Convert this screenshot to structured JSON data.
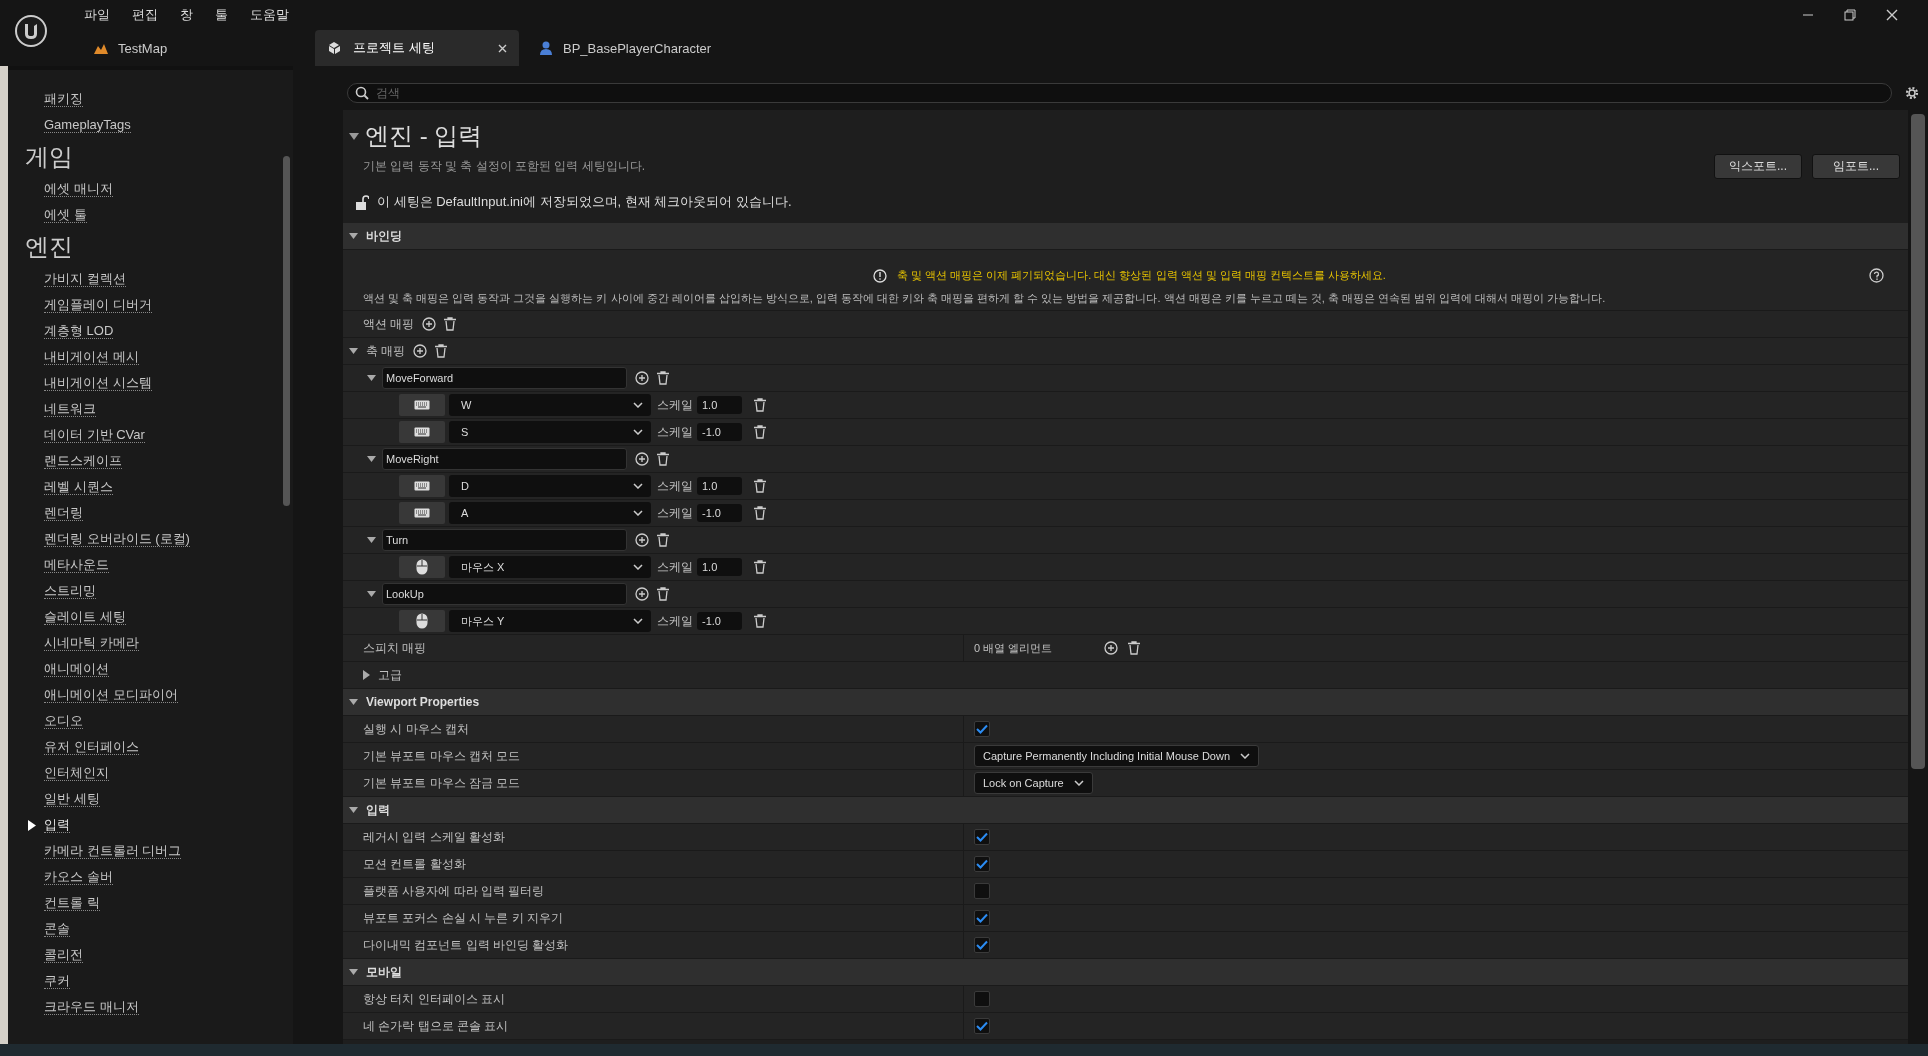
{
  "menu": [
    "파일",
    "편집",
    "창",
    "툴",
    "도움말"
  ],
  "tabs": [
    {
      "label": "TestMap",
      "kind": "map",
      "selected": false
    },
    {
      "label": "프로젝트 세팅",
      "kind": "settings",
      "selected": true
    },
    {
      "label": "BP_BasePlayerCharacter",
      "kind": "blueprint",
      "selected": false
    }
  ],
  "sidebar": {
    "items": [
      {
        "label": "패키징",
        "kind": "link",
        "selected": false
      },
      {
        "label": "GameplayTags",
        "kind": "link",
        "selected": false
      },
      {
        "label": "게임",
        "kind": "heading"
      },
      {
        "label": "에셋 매니저",
        "kind": "link",
        "selected": false
      },
      {
        "label": "에셋 툴",
        "kind": "link",
        "selected": false
      },
      {
        "label": "엔진",
        "kind": "heading"
      },
      {
        "label": "가비지 컬렉션",
        "kind": "link",
        "selected": false
      },
      {
        "label": "게임플레이 디버거",
        "kind": "link",
        "selected": false
      },
      {
        "label": "계층형 LOD",
        "kind": "link",
        "selected": false
      },
      {
        "label": "내비게이션 메시",
        "kind": "link",
        "selected": false
      },
      {
        "label": "내비게이션 시스템",
        "kind": "link",
        "selected": false
      },
      {
        "label": "네트워크",
        "kind": "link",
        "selected": false
      },
      {
        "label": "데이터 기반 CVar",
        "kind": "link",
        "selected": false
      },
      {
        "label": "랜드스케이프",
        "kind": "link",
        "selected": false
      },
      {
        "label": "레벨 시퀀스",
        "kind": "link",
        "selected": false
      },
      {
        "label": "렌더링",
        "kind": "link",
        "selected": false
      },
      {
        "label": "렌더링 오버라이드 (로컬)",
        "kind": "link",
        "selected": false
      },
      {
        "label": "메타사운드",
        "kind": "link",
        "selected": false
      },
      {
        "label": "스트리밍",
        "kind": "link",
        "selected": false
      },
      {
        "label": "슬레이트 세팅",
        "kind": "link",
        "selected": false
      },
      {
        "label": "시네마틱 카메라",
        "kind": "link",
        "selected": false
      },
      {
        "label": "애니메이션",
        "kind": "link",
        "selected": false
      },
      {
        "label": "애니메이션 모디파이어",
        "kind": "link",
        "selected": false
      },
      {
        "label": "오디오",
        "kind": "link",
        "selected": false
      },
      {
        "label": "유저 인터페이스",
        "kind": "link",
        "selected": false
      },
      {
        "label": "인터체인지",
        "kind": "link",
        "selected": false
      },
      {
        "label": "일반 세팅",
        "kind": "link",
        "selected": false
      },
      {
        "label": "입력",
        "kind": "link",
        "selected": true
      },
      {
        "label": "카메라 컨트롤러 디버그",
        "kind": "link",
        "selected": false
      },
      {
        "label": "카오스 솔버",
        "kind": "link",
        "selected": false
      },
      {
        "label": "컨트롤 릭",
        "kind": "link",
        "selected": false
      },
      {
        "label": "콘솔",
        "kind": "link",
        "selected": false
      },
      {
        "label": "콜리전",
        "kind": "link",
        "selected": false
      },
      {
        "label": "쿠커",
        "kind": "link",
        "selected": false
      },
      {
        "label": "크라우드 매니저",
        "kind": "link",
        "selected": false
      }
    ]
  },
  "search": {
    "placeholder": "검색"
  },
  "page": {
    "title": "엔진 - 입력",
    "description": "기본 입력 동작 및 축 설정이 포함된 입력 세팅입니다.",
    "buttons": [
      "익스포트...",
      "임포트..."
    ],
    "notice": "이 세팅은 DefaultInput.ini에 저장되었으며, 현재 체크아웃되어 있습니다."
  },
  "bindings": {
    "title": "바인딩",
    "expanded": true,
    "warning": "축 및 액션 매핑은 이제 폐기되었습니다. 대신 향상된 입력 액션 및 입력 매핑 컨텍스트를 사용하세요.",
    "description": "액션 및 축 매핑은 입력 동작과 그것을 실행하는 키 사이에 중간 레이어를 삽입하는 방식으로, 입력 동작에 대한 키와 축 매핑을 편하게 할 수 있는 방법을 제공합니다. 액션 매핑은 키를 누르고 떼는 것, 축 매핑은 연속된 범위 입력에 대해서 매핑이 가능합니다.",
    "action_mappings": {
      "label": "액션 매핑"
    },
    "axis_mappings": {
      "label": "축 매핑",
      "expanded": true,
      "axes": [
        {
          "name": "MoveForward",
          "expanded": true,
          "keys": [
            {
              "kind": "keyboard",
              "key": "W",
              "scale_label": "스케일",
              "scale": "1.0"
            },
            {
              "kind": "keyboard",
              "key": "S",
              "scale_label": "스케일",
              "scale": "-1.0"
            }
          ]
        },
        {
          "name": "MoveRight",
          "expanded": true,
          "keys": [
            {
              "kind": "keyboard",
              "key": "D",
              "scale_label": "스케일",
              "scale": "1.0"
            },
            {
              "kind": "keyboard",
              "key": "A",
              "scale_label": "스케일",
              "scale": "-1.0"
            }
          ]
        },
        {
          "name": "Turn",
          "expanded": true,
          "keys": [
            {
              "kind": "mouse",
              "key": "마우스 X",
              "scale_label": "스케일",
              "scale": "1.0"
            }
          ]
        },
        {
          "name": "LookUp",
          "expanded": true,
          "keys": [
            {
              "kind": "mouse",
              "key": "마우스 Y",
              "scale_label": "스케일",
              "scale": "-1.0"
            }
          ]
        }
      ]
    },
    "speech_mappings": {
      "label": "스피치 매핑",
      "value": "0 배열 엘리먼트"
    },
    "advanced": {
      "label": "고급",
      "expanded": false
    }
  },
  "sections": [
    {
      "title": "Viewport Properties",
      "expanded": true,
      "rows": [
        {
          "label": "실행 시 마우스 캡처",
          "kind": "checkbox",
          "checked": true
        },
        {
          "label": "기본 뷰포트 마우스 캡처 모드",
          "kind": "dropdown",
          "value": "Capture Permanently Including Initial Mouse Down"
        },
        {
          "label": "기본 뷰포트 마우스 잠금 모드",
          "kind": "dropdown",
          "value": "Lock on Capture"
        }
      ]
    },
    {
      "title": "입력",
      "expanded": true,
      "rows": [
        {
          "label": "레거시 입력 스케일 활성화",
          "kind": "checkbox",
          "checked": true
        },
        {
          "label": "모션 컨트롤 활성화",
          "kind": "checkbox",
          "checked": true
        },
        {
          "label": "플랫폼 사용자에 따라 입력 필터링",
          "kind": "checkbox",
          "checked": false
        },
        {
          "label": "뷰포트 포커스 손실 시 누른 키 지우기",
          "kind": "checkbox",
          "checked": true
        },
        {
          "label": "다이내믹 컴포넌트 입력 바인딩 활성화",
          "kind": "checkbox",
          "checked": true
        }
      ]
    },
    {
      "title": "모바일",
      "expanded": true,
      "rows": [
        {
          "label": "항상 터치 인터페이스 표시",
          "kind": "checkbox",
          "checked": false
        },
        {
          "label": "네 손가락 탭으로 콘솔 표시",
          "kind": "checkbox",
          "checked": true
        }
      ]
    }
  ]
}
